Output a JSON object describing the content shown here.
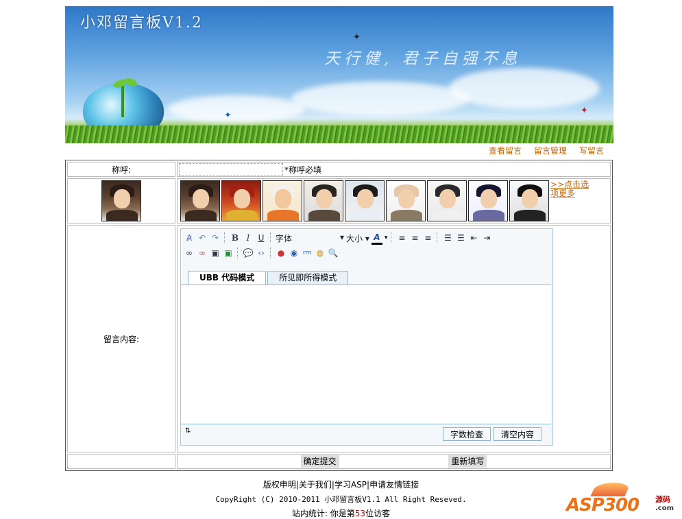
{
  "banner": {
    "title": "小邓留言板V1.2",
    "slogan": "天行健, 君子自强不息"
  },
  "nav": {
    "view": "查看留言",
    "manage": "留言管理",
    "write": "写留言"
  },
  "form": {
    "nickname_label": "称呼:",
    "nickname_value": "",
    "nickname_hint": "*称呼必填",
    "avatar_more": ">>点击选项更多",
    "content_label": "留言内容:"
  },
  "editor": {
    "font_label": "字体",
    "size_label": "大小",
    "tab_ubb": "UBB 代码模式",
    "tab_wysiwyg": "所见即所得模式",
    "count_button": "字数检查",
    "clear_button": "清空内容"
  },
  "actions": {
    "submit": "确定提交",
    "reset": "重新填写"
  },
  "footer": {
    "links": "版权申明|关于我们|学习ASP|申请友情链接",
    "copyright": "CopyRight (C) 2010-2011 小邓留言板V1.1 All Right Reseved.",
    "stats_prefix": "站内统计: 你是第",
    "visitor_count": "53",
    "stats_suffix": "位访客"
  },
  "logo": {
    "brand": "ASP300",
    "suffix_cn": "源码",
    "suffix_com": ".com"
  },
  "colors": {
    "link": "#c6650a",
    "counter": "#cc0000",
    "editor_border": "#8fb4d0"
  }
}
